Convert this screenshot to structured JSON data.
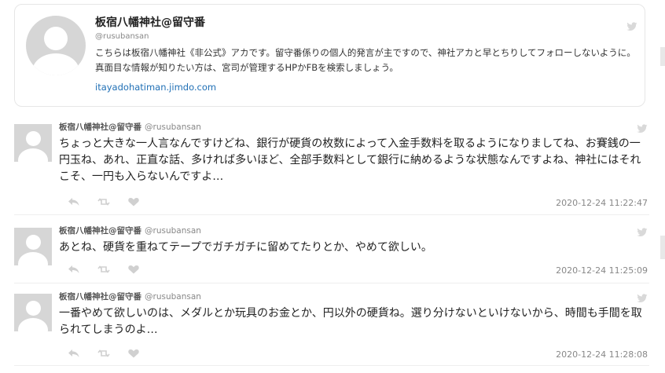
{
  "profile": {
    "name": "板宿八幡神社@留守番",
    "handle": "@rusubansan",
    "bio": "こちらは板宿八幡神社《非公式》アカです。留守番係りの個人的発言が主ですので、神社アカと早とちりしてフォローしないように。真面目な情報が知りたい方は、宮司が管理するHPかFBを検索しましょう。",
    "link": "itayadohatiman.jimdo.com"
  },
  "tweets": [
    {
      "name": "板宿八幡神社@留守番",
      "handle": "@rusubansan",
      "text": "ちょっと大きな一人言なんですけどね、銀行が硬貨の枚数によって入金手数料を取るようになりましてね、お賽銭の一円玉ね、あれ、正直な話、多ければ多いほど、全部手数料として銀行に納めるような状態なんですよね、神社にはそれこそ、一円も入らないんですよ…",
      "time": "2020-12-24 11:22:47"
    },
    {
      "name": "板宿八幡神社@留守番",
      "handle": "@rusubansan",
      "text": "あとね、硬貨を重ねてテープでガチガチに留めてたりとか、やめて欲しい。",
      "time": "2020-12-24 11:25:09"
    },
    {
      "name": "板宿八幡神社@留守番",
      "handle": "@rusubansan",
      "text": "一番やめて欲しいのは、メダルとか玩具のお金とか、円以外の硬貨ね。選り分けないといけないから、時間も手間を取られてしまうのよ…",
      "time": "2020-12-24 11:28:08"
    }
  ],
  "icons": {
    "reply": "reply-icon",
    "retweet": "retweet-icon",
    "like": "heart-icon",
    "bird": "twitter-bird-icon"
  },
  "colors": {
    "link": "#1f6fb5",
    "muted": "#888888",
    "icon": "#d0d0d0"
  }
}
